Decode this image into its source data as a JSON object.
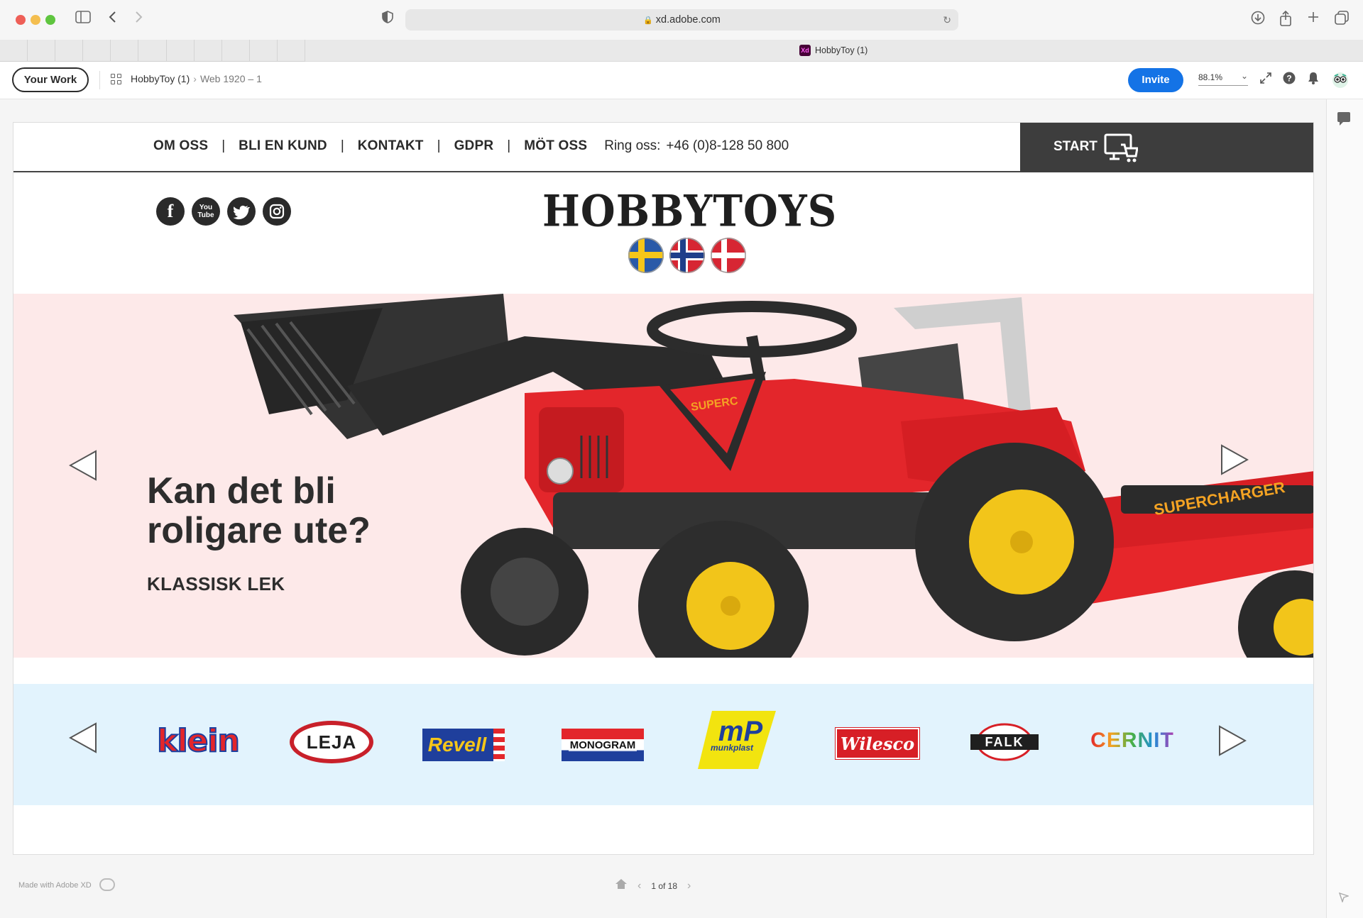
{
  "browser": {
    "url": "xd.adobe.com",
    "tab_title": "HobbyToy (1)",
    "tab_badge": "Xd"
  },
  "toolbar": {
    "your_work": "Your Work",
    "breadcrumb_project": "HobbyToy (1)",
    "breadcrumb_artboard": "Web 1920 – 1",
    "invite": "Invite",
    "zoom": "88.1%"
  },
  "site": {
    "nav": [
      "OM OSS",
      "BLI EN KUND",
      "KONTAKT",
      "GDPR",
      "MÖT OSS"
    ],
    "phone_label": "Ring oss:",
    "phone_number": "+46 (0)8-128 50 800",
    "start": "START",
    "logo": "HOBBYTOYS",
    "social": {
      "facebook": "f",
      "youtube_top": "You",
      "youtube_bottom": "Tube"
    },
    "flags": [
      "sweden-flag",
      "norway-flag",
      "denmark-flag"
    ],
    "hero": {
      "title_line1": "Kan det bli",
      "title_line2": "roligare ute?",
      "subtitle": "KLASSISK LEK",
      "tractor_decal": "SUPERC",
      "trailer_decal": "SUPERCHARGER"
    },
    "brands": [
      "klein",
      "LEJA",
      "Revell",
      "MONOGRAM",
      "munkplast",
      "Wilesco",
      "FALK",
      "CERNIT"
    ],
    "brand_mp": "mP"
  },
  "footer": {
    "made_with": "Made with Adobe XD",
    "pager": "1 of 18"
  },
  "colors": {
    "accent": "#1473e6",
    "hero_bg": "#fde9e9",
    "brands_bg": "#e2f3fd",
    "start_bg": "#3d3d3d"
  }
}
